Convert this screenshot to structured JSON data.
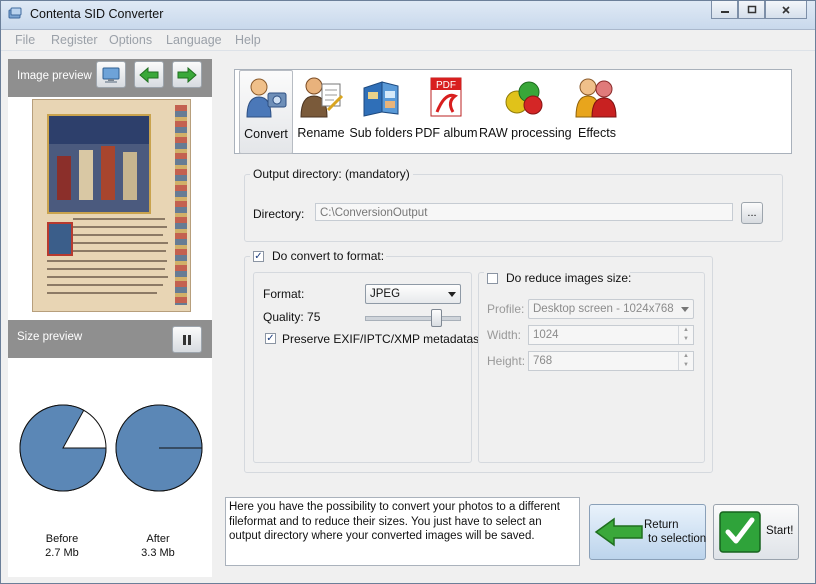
{
  "window": {
    "title": "Contenta SID Converter",
    "controls": [
      "minimize-icon",
      "maximize-icon",
      "close-icon"
    ]
  },
  "menu": [
    "File",
    "Register",
    "Options",
    "Language",
    "Help"
  ],
  "left_panel": {
    "image_preview_label": "Image preview",
    "size_preview_label": "Size preview",
    "before": {
      "label": "Before",
      "size": "2.7 Mb",
      "fill_fraction": 0.83
    },
    "after": {
      "label": "After",
      "size": "3.3 Mb",
      "fill_fraction": 1.0
    }
  },
  "toolbar": {
    "items": [
      {
        "label": "Convert",
        "icon": "convert-icon",
        "selected": true
      },
      {
        "label": "Rename",
        "icon": "rename-icon",
        "selected": false
      },
      {
        "label": "Sub folders",
        "icon": "sub-folders-icon",
        "selected": false
      },
      {
        "label": "PDF album",
        "icon": "pdf-album-icon",
        "selected": false
      },
      {
        "label": "RAW processing",
        "icon": "raw-processing-icon",
        "selected": false
      },
      {
        "label": "Effects",
        "icon": "effects-icon",
        "selected": false
      }
    ],
    "pdf_badge": "PDF"
  },
  "output": {
    "legend": "Output directory: (mandatory)",
    "directory_label": "Directory:",
    "directory_value": "C:\\ConversionOutput",
    "browse_label": "..."
  },
  "convert": {
    "checkbox_label": "Do convert to format:",
    "checked": true,
    "format_label": "Format:",
    "format_value": "JPEG",
    "quality_label": "Quality: 75",
    "quality_value": 75,
    "preserve_label": "Preserve EXIF/IPTC/XMP metadatas",
    "preserve_checked": true
  },
  "reduce": {
    "checkbox_label": "Do reduce images size:",
    "checked": false,
    "profile_label": "Profile:",
    "profile_value": "Desktop screen - 1024x768",
    "width_label": "Width:",
    "width_value": "1024",
    "height_label": "Height:",
    "height_value": "768"
  },
  "hint": "Here you have the possibility to convert your photos to a different fileformat and to reduce their sizes. You just have to select an output directory where your converted images will be saved.",
  "buttons": {
    "return_line1": "Return",
    "return_line2": "to selection",
    "start": "Start!"
  },
  "colors": {
    "pie_fill": "#5b87b6",
    "panel_header": "#8f8f8f",
    "green_arrow": "#3aa83a"
  }
}
